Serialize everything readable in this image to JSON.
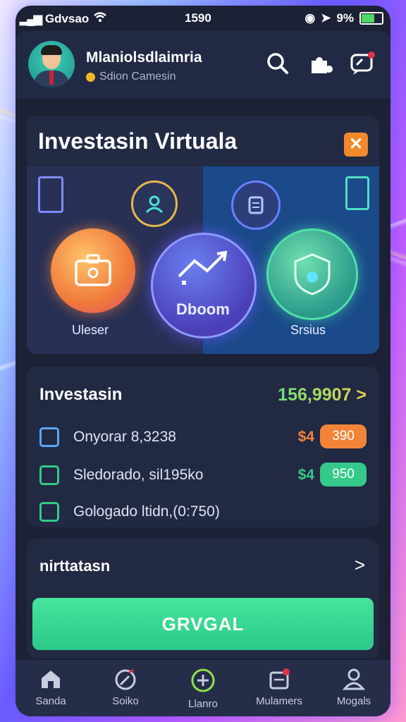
{
  "status_bar": {
    "carrier": "Gdvsao",
    "time": "1590",
    "battery_percent": "9%"
  },
  "header": {
    "username": "Mlaniolsdlaimria",
    "subtitle": "Sdion Camesin"
  },
  "hero": {
    "title": "Investasin Virtuala",
    "close_label": "✕",
    "items": [
      {
        "label": "Uleser"
      },
      {
        "label": "Dboom"
      },
      {
        "label": "Srsius"
      }
    ]
  },
  "investments": {
    "title": "Investasin",
    "total": "156,9907 >",
    "rows": [
      {
        "label": "Onyorar 8,3238",
        "currency": "$4",
        "value": "390",
        "pill_color": "#f2843a",
        "check_color": "#5aa8ff"
      },
      {
        "label": "Sledorado, sil195ko",
        "currency": "$4",
        "value": "950",
        "pill_color": "#35c98a",
        "check_color": "#35c98a"
      },
      {
        "label": "Gologado ltidn,(0:750)",
        "currency": "",
        "value": "",
        "pill_color": "",
        "check_color": "#35c98a"
      }
    ]
  },
  "section2": {
    "title": "nirttatasn",
    "chevron": ">"
  },
  "cta": {
    "label": "GRVGAL"
  },
  "nav": {
    "items": [
      {
        "label": "Sanda",
        "icon": "home-icon"
      },
      {
        "label": "Soiko",
        "icon": "compass-icon"
      },
      {
        "label": "Llanro",
        "icon": "plus-circle-icon"
      },
      {
        "label": "Mulamers",
        "icon": "calendar-icon"
      },
      {
        "label": "Mogals",
        "icon": "user-icon"
      }
    ]
  },
  "colors": {
    "accent_green": "#35c98a",
    "accent_orange": "#f2843a",
    "panel": "#222943"
  }
}
